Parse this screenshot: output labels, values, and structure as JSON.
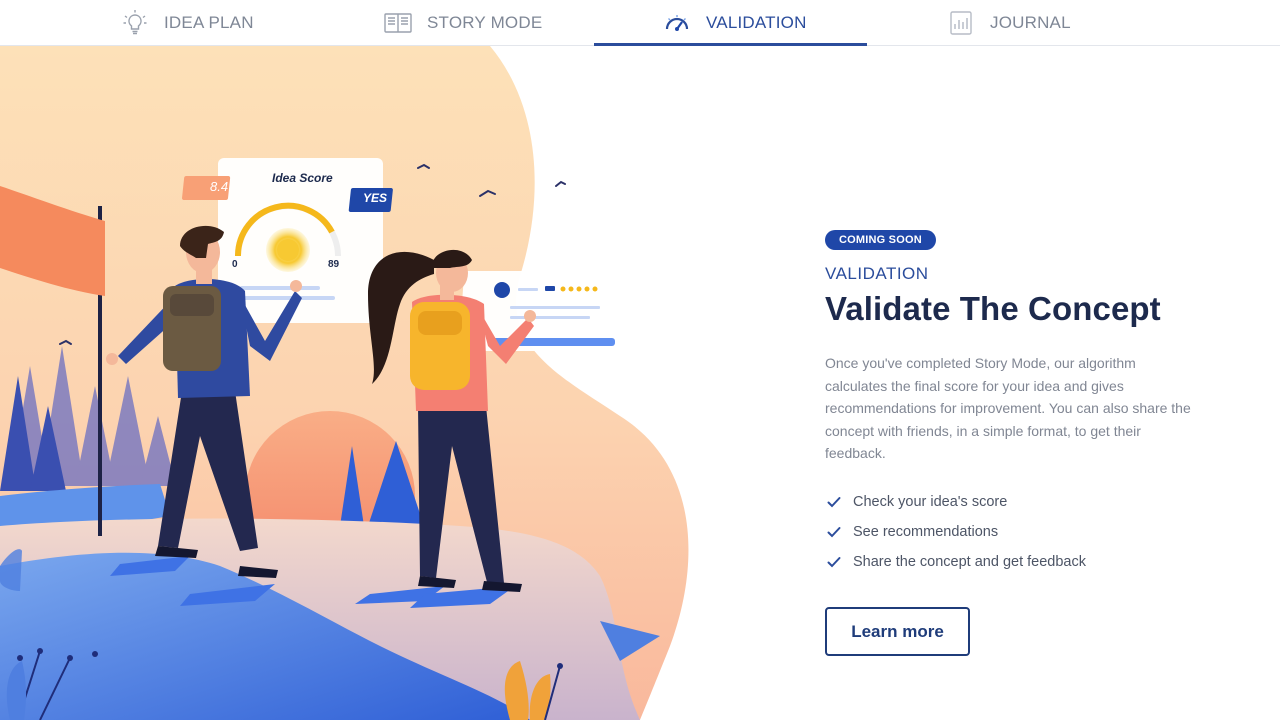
{
  "tabs": [
    {
      "label": "IDEA PLAN",
      "icon": "lightbulb-icon",
      "active": false
    },
    {
      "label": "STORY MODE",
      "icon": "book-icon",
      "active": false
    },
    {
      "label": "VALIDATION",
      "icon": "gauge-icon",
      "active": true
    },
    {
      "label": "JOURNAL",
      "icon": "chart-document-icon",
      "active": false
    }
  ],
  "illustration": {
    "score_card": {
      "title": "Idea Score",
      "score_tag": "8.4",
      "verdict_tag": "YES",
      "gauge_min": "0",
      "gauge_max": "89"
    }
  },
  "section": {
    "badge": "COMING SOON",
    "eyebrow": "VALIDATION",
    "headline": "Validate The Concept",
    "description": "Once you've completed Story Mode, our algorithm calculates the final score for your idea and gives recommendations for improvement. You can also share the concept with friends, in a simple format, to get their feedback.",
    "checklist": [
      "Check your idea's score",
      "See recommendations",
      "Share the concept and get feedback"
    ],
    "cta_label": "Learn more"
  },
  "colors": {
    "accent": "#2b4d9c",
    "badge": "#1f47a8",
    "headline": "#1d2a4d",
    "body_text": "#808693",
    "sunset_peach": "#f9c79c",
    "water_blue": "#4f86e8"
  }
}
